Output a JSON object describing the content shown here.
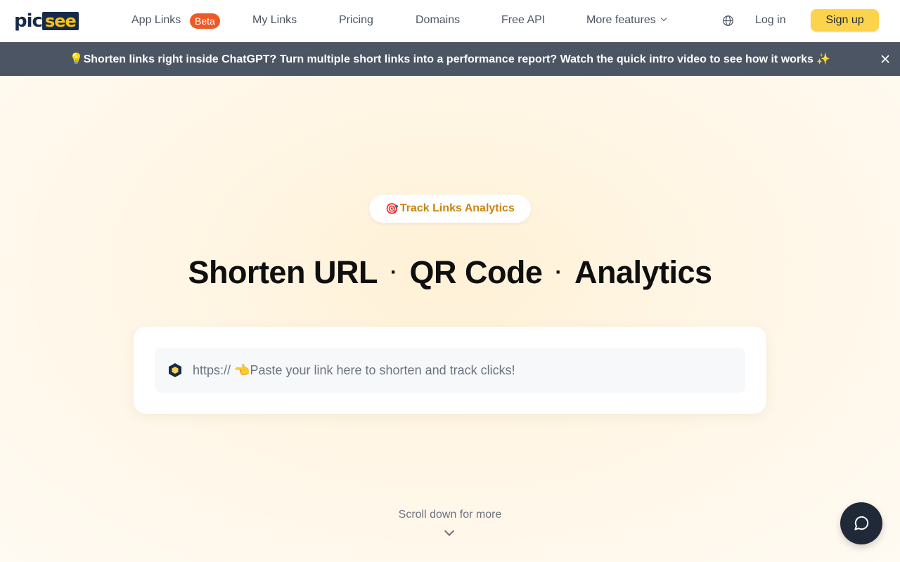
{
  "brand": {
    "logo_left": "pic",
    "logo_right": "see"
  },
  "nav": {
    "items": [
      {
        "label": "App Links",
        "badge": "Beta"
      },
      {
        "label": "My Links"
      },
      {
        "label": "Pricing"
      },
      {
        "label": "Domains"
      },
      {
        "label": "Free API"
      },
      {
        "label": "More features"
      }
    ],
    "login": "Log in",
    "signup": "Sign up"
  },
  "banner": {
    "text": "💡Shorten links right inside ChatGPT? Turn multiple short links into a performance report? Watch the quick intro video to see how it works ✨"
  },
  "hero": {
    "pill_emoji": "🎯",
    "pill_label": "Track Links Analytics",
    "headline_parts": [
      "Shorten URL",
      "QR Code",
      "Analytics"
    ],
    "separator": "·",
    "input_placeholder": "https:// 👈Paste your link here to shorten and track clicks!",
    "scroll_text": "Scroll down for more"
  },
  "colors": {
    "brand_navy": "#172a4a",
    "brand_yellow": "#fcd34d",
    "banner_bg": "#4b5563",
    "pill_text": "#c8860d",
    "beta_badge": "#ee5a24"
  },
  "icons": {
    "globe": "globe-icon",
    "close": "close-icon",
    "chevron": "chevron-down-icon",
    "chat": "chat-bubble-icon",
    "input_logo": "picsee-hexagon-icon"
  }
}
